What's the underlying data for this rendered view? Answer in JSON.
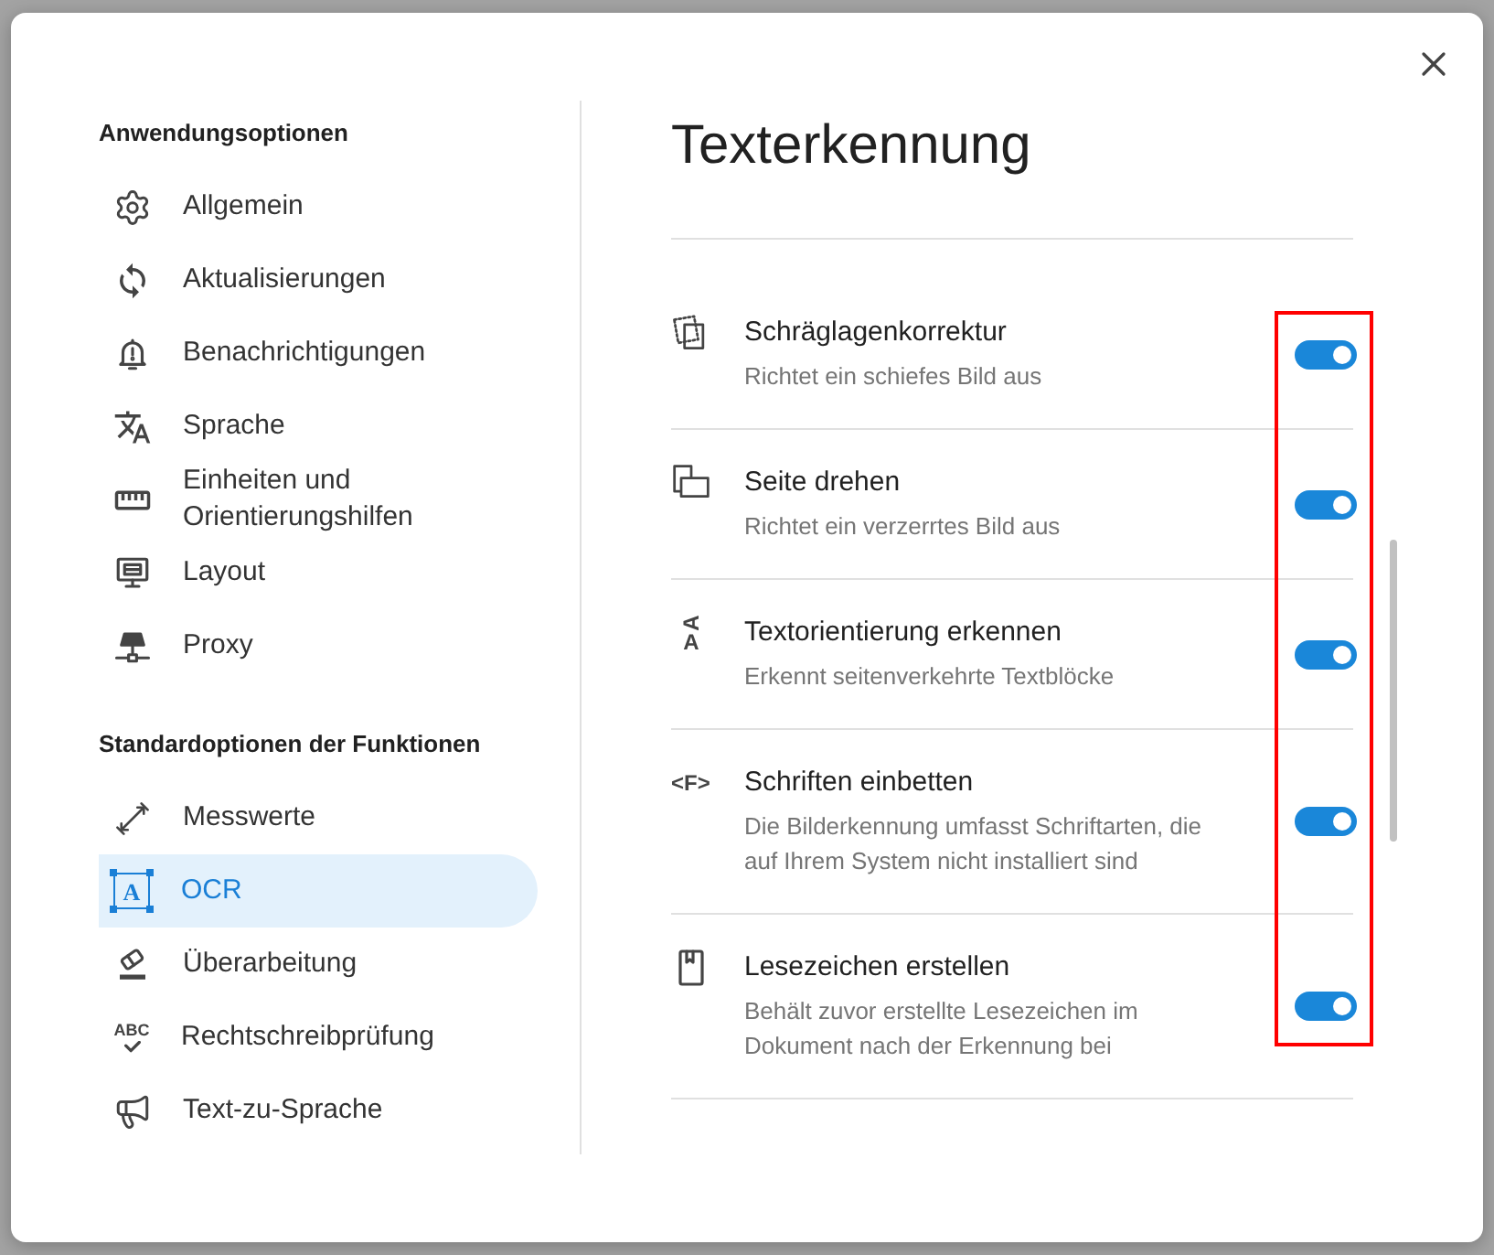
{
  "sidebar": {
    "sections": [
      {
        "heading": "Anwendungsoptionen",
        "items": [
          {
            "label": "Allgemein",
            "selected": false
          },
          {
            "label": "Aktualisierungen",
            "selected": false
          },
          {
            "label": "Benachrichtigungen",
            "selected": false
          },
          {
            "label": "Sprache",
            "selected": false
          },
          {
            "label": "Einheiten und Orientierungshilfen",
            "selected": false
          },
          {
            "label": "Layout",
            "selected": false
          },
          {
            "label": "Proxy",
            "selected": false
          }
        ]
      },
      {
        "heading": "Standardoptionen der Funktionen",
        "items": [
          {
            "label": "Messwerte",
            "selected": false
          },
          {
            "label": "OCR",
            "selected": true,
            "icon_text": "A"
          },
          {
            "label": "Überarbeitung",
            "selected": false
          },
          {
            "label": "Rechtschreibprüfung",
            "selected": false,
            "icon_text": "ABC"
          },
          {
            "label": "Text-zu-Sprache",
            "selected": false
          }
        ]
      }
    ]
  },
  "content": {
    "title": "Texterkennung",
    "toggles_highlighted": true,
    "settings": [
      {
        "title": "Schräglagenkorrektur",
        "description": "Richtet ein schiefes Bild aus",
        "on": true
      },
      {
        "title": "Seite drehen",
        "description": "Richtet ein verzerrtes Bild aus",
        "on": true
      },
      {
        "title": "Textorientierung erkennen",
        "description": "Erkennt seitenverkehrte Textblöcke",
        "on": true,
        "icon_text": [
          "A",
          "A"
        ]
      },
      {
        "title": "Schriften einbetten",
        "description": "Die Bilderkennung umfasst Schriftarten, die auf Ihrem System nicht installiert sind",
        "on": true,
        "icon_text": "<F>"
      },
      {
        "title": "Lesezeichen erstellen",
        "description": "Behält zuvor erstellte Lesezeichen im Dokument nach der Erkennung bei",
        "on": true
      }
    ]
  }
}
